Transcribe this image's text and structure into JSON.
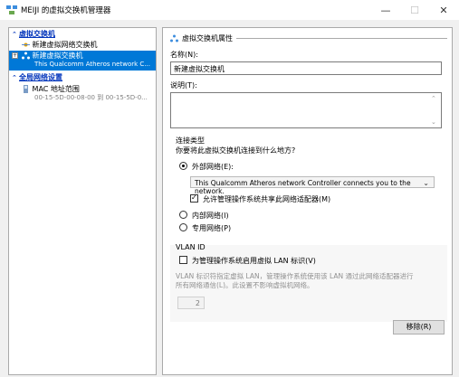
{
  "window": {
    "title": "MEIJI 的虚拟交换机管理器",
    "min": "—",
    "max": "☐",
    "close": "✕"
  },
  "tree": {
    "cat_switch": "虚拟交换机",
    "new_switch_item": "新建虚拟网络交换机",
    "selected_item": "新建虚拟交换机",
    "selected_sub": "This Qualcomm Atheros network C...",
    "cat_global": "全局网络设置",
    "mac_item": "MAC 地址范围",
    "mac_sub": "00-15-5D-00-08-00 到 00-15-5D-0..."
  },
  "props": {
    "section_title": "虚拟交换机属性",
    "name_label": "名称(N):",
    "name_value": "新建虚拟交换机",
    "desc_label": "说明(T):",
    "conn_type_label": "连接类型",
    "conn_question": "你要将此虚拟交换机连接到什么地方?",
    "radio_external": "外部网络(E):",
    "adapter_value": "This Qualcomm Atheros network Controller connects you to the network.",
    "allow_os_share": "允许管理操作系统共享此网络适配器(M)",
    "radio_internal": "内部网络(I)",
    "radio_private": "专用网络(P)",
    "vlan_title": "VLAN ID",
    "vlan_enable": "为管理操作系统启用虚拟 LAN 标识(V)",
    "vlan_hint_1": "VLAN 标识符指定虚拟 LAN，管理操作系统使用该 LAN 通过此网络适配器进行",
    "vlan_hint_2": "所有网络通信(L)。此设置不影响虚拟机网络。",
    "vlan_value": "2",
    "remove_button": "移除(R)"
  },
  "colors": {
    "selection": "#0078d7",
    "category": "#0033bb"
  }
}
